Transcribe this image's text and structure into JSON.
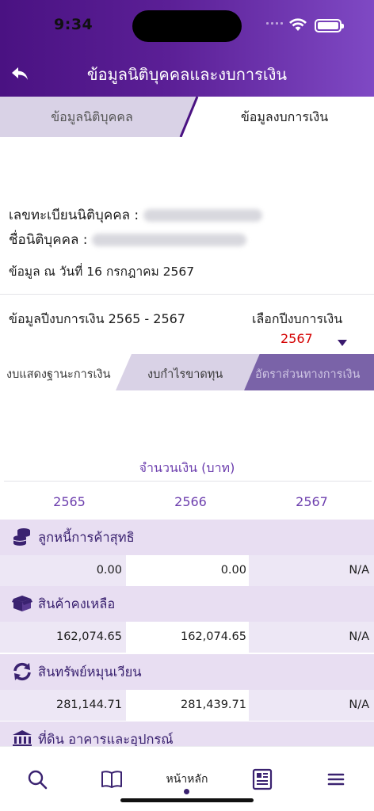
{
  "status": {
    "time": "9:34"
  },
  "header": {
    "title": "ข้อมูลนิติบุคคลและงบการเงิน"
  },
  "tabs": [
    {
      "label": "ข้อมูลนิติบุคคล",
      "active": false
    },
    {
      "label": "ข้อมูลงบการเงิน",
      "active": true
    }
  ],
  "company": {
    "registration_label": "เลขทะเบียนนิติบุคคล :",
    "name_label": "ชื่อนิติบุคคล :",
    "as_of": "ข้อมูล ณ วันที่ 16 กรกฎาคม 2567"
  },
  "fiscal": {
    "range_label": "ข้อมูลปีงบการเงิน 2565 - 2567",
    "select_label": "เลือกปีงบการเงิน",
    "selected_year": "2567"
  },
  "subtabs": [
    {
      "label": "งบแสดงฐานะการเงิน"
    },
    {
      "label": "งบกำไรขาดทุน"
    },
    {
      "label": "อัตราส่วนทางการเงิน"
    }
  ],
  "table": {
    "amount_header": "จำนวนเงิน (บาท)",
    "years": [
      "2565",
      "2566",
      "2567"
    ],
    "rows": [
      {
        "label": "ลูกหนี้การค้าสุทธิ",
        "icon": "coins-icon",
        "values": [
          "0.00",
          "0.00",
          "N/A"
        ]
      },
      {
        "label": "สินค้าคงเหลือ",
        "icon": "box-icon",
        "values": [
          "162,074.65",
          "162,074.65",
          "N/A"
        ]
      },
      {
        "label": "สินทรัพย์หมุนเวียน",
        "icon": "refresh-icon",
        "values": [
          "281,144.71",
          "281,439.71",
          "N/A"
        ]
      },
      {
        "label": "ที่ดิน อาคารและอุปกรณ์",
        "icon": "bank-icon"
      }
    ]
  },
  "bottom_nav": {
    "home_label": "หน้าหลัก"
  },
  "colors": {
    "primary": "#4a1282",
    "accent": "#6d3fae",
    "selected_year": "#d40000"
  }
}
